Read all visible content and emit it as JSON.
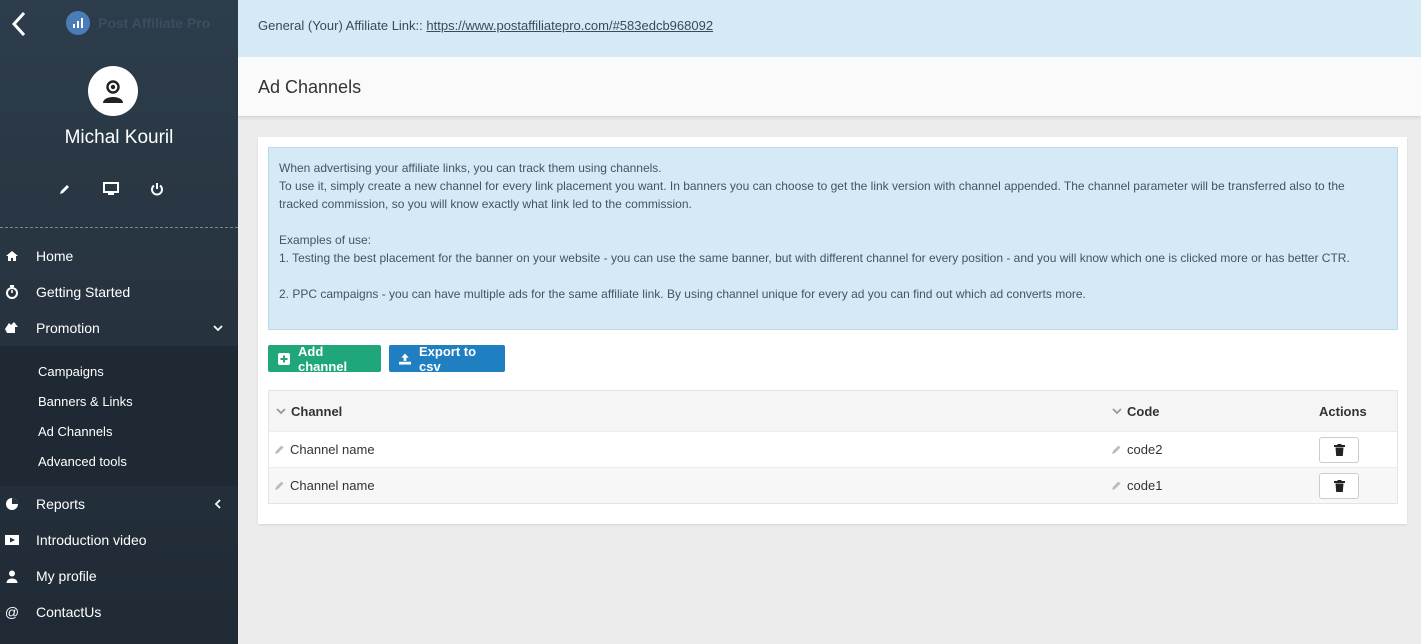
{
  "sidebar": {
    "logo_text": "Post Affiliate Pro",
    "user_name": "Michal Kouril",
    "nav": [
      {
        "label": "Home"
      },
      {
        "label": "Getting Started"
      },
      {
        "label": "Promotion"
      },
      {
        "label": "Reports"
      },
      {
        "label": "Introduction video"
      },
      {
        "label": "My profile"
      },
      {
        "label": "ContactUs"
      }
    ],
    "promotion_sub": [
      {
        "label": "Campaigns"
      },
      {
        "label": "Banners & Links"
      },
      {
        "label": "Ad Channels"
      },
      {
        "label": "Advanced tools"
      }
    ]
  },
  "linkbar": {
    "label": "General (Your) Affiliate Link::",
    "url": "https://www.postaffiliatepro.com/#583edcb968092"
  },
  "page": {
    "title": "Ad Channels"
  },
  "info": {
    "line1": "When advertising your affiliate links, you can track them using channels.",
    "line2": "To use it, simply create a new channel for every link placement you want. In banners you can choose to get the link version with channel appended. The channel parameter will be transferred also to the tracked commission, so you will know exactly what link led to the commission.",
    "line3": "Examples of use:",
    "line4": "1. Testing the best placement for the banner on your website - you can use the same banner, but with different channel for every position - and you will know which one is clicked more or has better CTR.",
    "line5": "2. PPC campaigns - you can have multiple ads for the same affiliate link. By using channel unique for every ad you can find out which ad converts more."
  },
  "buttons": {
    "add_channel": "Add channel",
    "export_csv": "Export to csv"
  },
  "table": {
    "headers": {
      "channel": "Channel",
      "code": "Code",
      "actions": "Actions"
    },
    "rows": [
      {
        "channel": "Channel name",
        "code": "code2"
      },
      {
        "channel": "Channel name",
        "code": "code1"
      }
    ]
  },
  "colors": {
    "sidebar_bg": "#26323e",
    "info_bg": "#d6eaf6",
    "add_button": "#1fa67a",
    "export_button": "#1f7fc1"
  }
}
